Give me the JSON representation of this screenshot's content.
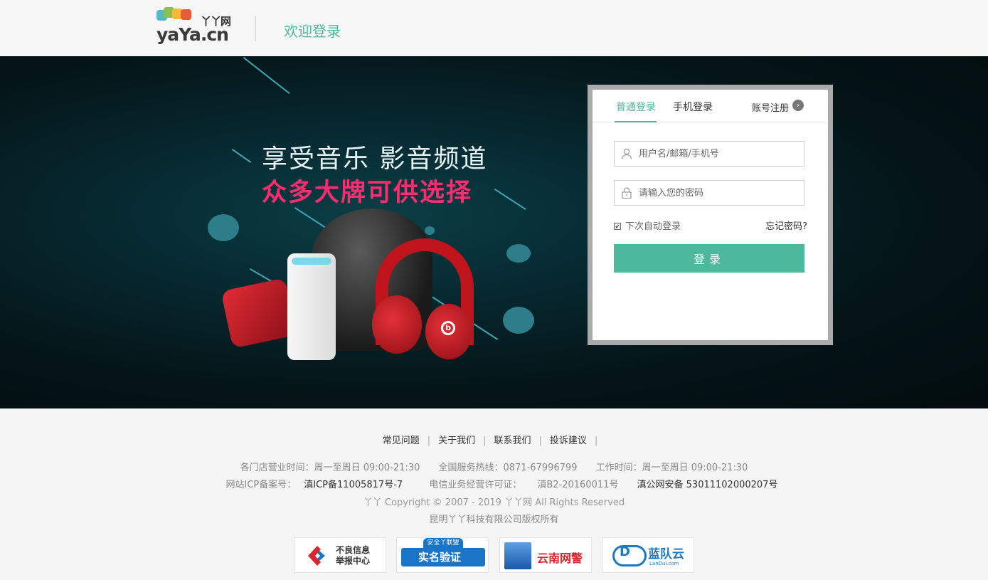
{
  "header": {
    "logo_cn": "丫丫网",
    "logo_en": "yaYa.cn",
    "welcome": "欢迎登录"
  },
  "banner": {
    "slogan_line1": "享受音乐 影音频道",
    "slogan_line2": "众多大牌可供选择"
  },
  "login": {
    "tab_normal": "普通登录",
    "tab_phone": "手机登录",
    "register_label": "账号注册",
    "username_placeholder": "用户名/邮箱/手机号",
    "password_placeholder": "请输入您的密码",
    "remember_label": "下次自动登录",
    "remember_checked": true,
    "forgot_label": "忘记密码?",
    "submit_label": "登录",
    "accent_color": "#4db89c"
  },
  "footer": {
    "links": [
      "常见问题",
      "关于我们",
      "联系我们",
      "投诉建议"
    ],
    "store_hours": "各门店营业时间：周一至周日 09:00-21:30",
    "hotline": "全国服务热线：0871-67996799",
    "work_hours": "工作时间：周一至周日 09:00-21:30",
    "icp_label": "网站ICP备案号：",
    "icp_value": "滇ICP备11005817号-7",
    "telecom_label": "电信业务经营许可证：",
    "telecom_value": "滇B2-20160011号",
    "police_value": "滇公网安备 53011102000207号",
    "copyright": "丫丫 Copyright © 2007 - 2019 丫丫网 All Rights Reserved",
    "company": "昆明丫丫科技有限公司版权所有",
    "badges": {
      "report_line1": "不良信息",
      "report_line2": "举报中心",
      "alliance_top": "安全丫联盟",
      "alliance_main": "实名验证",
      "police": "云南网警",
      "landui": "蓝队云",
      "landui_sub": "LanDui.com"
    }
  }
}
